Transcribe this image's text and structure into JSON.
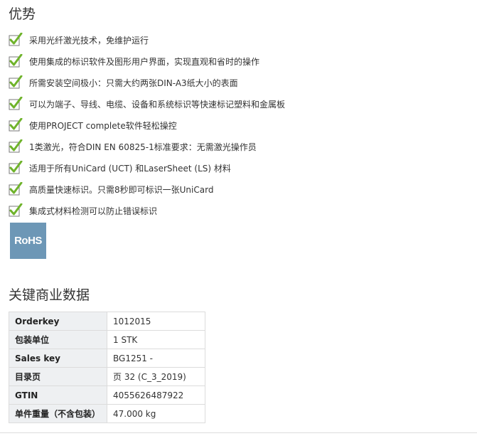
{
  "advantages": {
    "title": "优势",
    "items": [
      "采用光纤激光技术，免维护运行",
      "使用集成的标识软件及图形用户界面，实现直观和省时的操作",
      "所需安装空间极小：只需大约两张DIN-A3纸大小的表面",
      "可以为端子、导线、电缆、设备和系统标识等快速标记塑料和金属板",
      "使用PROJECT complete软件轻松操控",
      "1类激光，符合DIN EN 60825-1标准要求：无需激光操作员",
      "适用于所有UniCard (UCT) 和LaserSheet (LS) 材料",
      "高质量快速标识。只需8秒即可标识一张UniCard",
      "集成式材料检测可以防止错误标识"
    ],
    "check_icon": "green-checkmark-icon",
    "check_color": "#6fb32b",
    "rohs_label": "RoHS",
    "rohs_color": "#6d97b6"
  },
  "key_data": {
    "title": "关键商业数据",
    "rows": [
      {
        "key": "Orderkey",
        "value": "1012015"
      },
      {
        "key": "包装单位",
        "value": "1 STK"
      },
      {
        "key": "Sales key",
        "value": "BG1251 -"
      },
      {
        "key": "目录页",
        "value": "页 32 (C_3_2019)"
      },
      {
        "key": "GTIN",
        "value": "4055626487922"
      },
      {
        "key": "单件重量（不含包装）",
        "value": "47.000 kg"
      }
    ]
  }
}
